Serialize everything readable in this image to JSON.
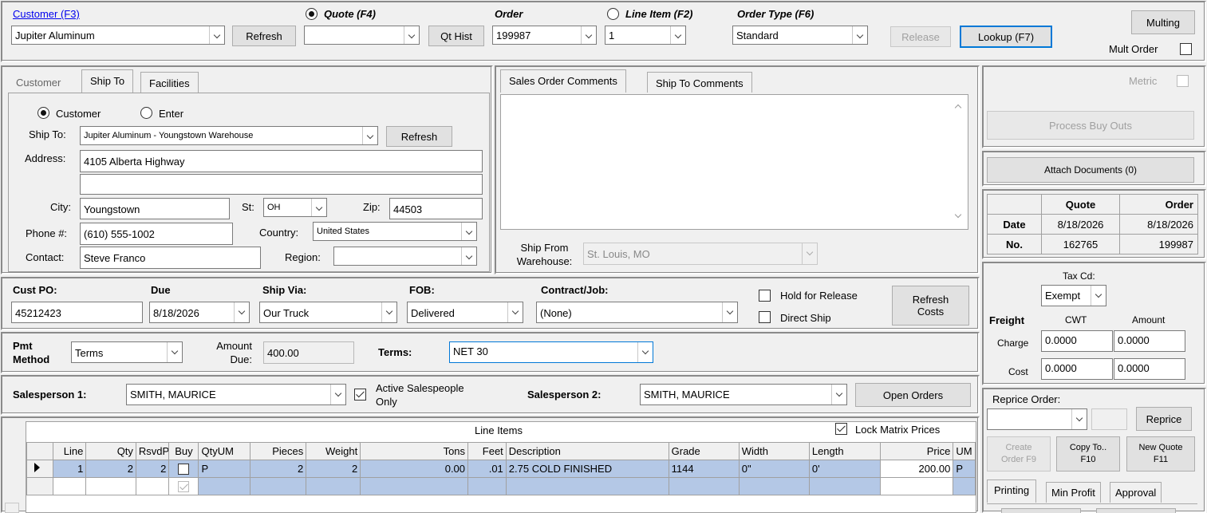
{
  "top": {
    "customer_link": "Customer (F3)",
    "customer_value": "Jupiter Aluminum",
    "refresh_label": "Refresh",
    "quote_label": "Quote (F4)",
    "quote_value": "",
    "qt_hist_label": "Qt Hist",
    "order_label": "Order",
    "order_value": "199987",
    "line_item_label": "Line Item (F2)",
    "line_item_value": "1",
    "order_type_label": "Order Type (F6)",
    "order_type_value": "Standard",
    "release_label": "Release",
    "lookup_label": "Lookup (F7)",
    "multing_label": "Multing",
    "mult_order_label": "Mult Order"
  },
  "shipto": {
    "tabs": [
      "Customer",
      "Ship To",
      "Facilities"
    ],
    "radio_customer": "Customer",
    "radio_enter": "Enter",
    "ship_to_label": "Ship To:",
    "ship_to_value": "Jupiter Aluminum - Youngstown Warehouse",
    "refresh_label": "Refresh",
    "address_label": "Address:",
    "address1": "4105 Alberta Highway",
    "address2": "",
    "city_label": "City:",
    "city": "Youngstown",
    "state_label": "St:",
    "state": "OH",
    "zip_label": "Zip:",
    "zip": "44503",
    "phone_label": "Phone #:",
    "phone": "(610) 555-1002",
    "country_label": "Country:",
    "country": "United States",
    "contact_label": "Contact:",
    "contact": "Steve Franco",
    "region_label": "Region:",
    "region": ""
  },
  "comments": {
    "tabs": [
      "Sales Order Comments",
      "Ship To Comments"
    ],
    "text": "",
    "ship_from_label": "Ship From Warehouse:",
    "ship_from_value": "St. Louis, MO"
  },
  "order": {
    "cust_po_label": "Cust PO:",
    "cust_po": "45212423",
    "due_label": "Due",
    "due": "8/18/2026",
    "ship_via_label": "Ship Via:",
    "ship_via": "Our Truck",
    "fob_label": "FOB:",
    "fob": "Delivered",
    "contract_label": "Contract/Job:",
    "contract": "(None)",
    "hold_label": "Hold for Release",
    "direct_ship_label": "Direct Ship",
    "refresh_costs_label": "Refresh Costs"
  },
  "payment": {
    "pmt_method_label": "Pmt Method",
    "pmt_method": "Terms",
    "amount_due_label": "Amount Due:",
    "amount_due": "400.00",
    "terms_label": "Terms:",
    "terms": "NET 30"
  },
  "sales": {
    "sp1_label": "Salesperson 1:",
    "sp1": "SMITH, MAURICE",
    "active_only_label": "Active Salespeople Only",
    "sp2_label": "Salesperson 2:",
    "sp2": "SMITH, MAURICE",
    "open_orders_label": "Open Orders"
  },
  "lines": {
    "title": "Line Items",
    "lock_label": "Lock Matrix Prices",
    "columns": [
      "Line",
      "Qty",
      "RsvdP",
      "Buy",
      "QtyUM",
      "Pieces",
      "Weight",
      "Tons",
      "Feet",
      "Description",
      "Grade",
      "Width",
      "Length",
      "Price",
      "UM"
    ],
    "rows": [
      {
        "line": "1",
        "qty": "2",
        "rsvdp": "2",
        "qtyum": "P",
        "pieces": "2",
        "weight": "2",
        "tons": "0.00",
        "feet": ".01",
        "description": "2.75 COLD FINISHED",
        "grade": "1144",
        "width": "0\"",
        "length": "0'",
        "price": "200.00",
        "um": "P"
      }
    ]
  },
  "right": {
    "metric_label": "Metric",
    "process_buyouts_label": "Process Buy Outs",
    "attach_docs_label": "Attach Documents (0)",
    "info_headers": [
      "Quote",
      "Order"
    ],
    "date_label": "Date",
    "quote_date": "8/18/2026",
    "order_date": "8/18/2026",
    "no_label": "No.",
    "quote_no": "162765",
    "order_no": "199987",
    "tax_cd_label": "Tax Cd:",
    "tax_cd": "Exempt",
    "freight_label": "Freight",
    "cwt_label": "CWT",
    "amount_label": "Amount",
    "charge_label": "Charge",
    "charge_cwt": "0.0000",
    "charge_amount": "0.0000",
    "cost_label": "Cost",
    "cost_cwt": "0.0000",
    "cost_amount": "0.0000",
    "reprice_order_label": "Reprice Order:",
    "reprice_label": "Reprice",
    "create_order_label": "Create Order F9",
    "copy_to_label": "Copy To.. F10",
    "new_quote_label": "New Quote F11",
    "bottom_tabs": [
      "Printing",
      "Min Profit",
      "Approval"
    ]
  }
}
